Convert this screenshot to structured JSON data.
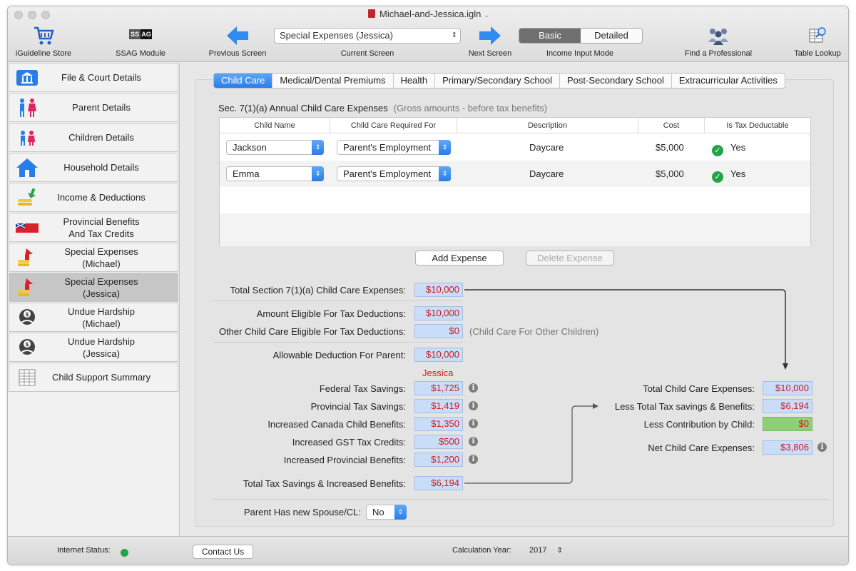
{
  "window": {
    "title": "Michael-and-Jessica.igln"
  },
  "toolbar": {
    "store_label": "iGuideline Store",
    "ssag_label": "SSAG Module",
    "ssag_badge_left": "SS",
    "ssag_badge_right": "AG",
    "prev_label": "Previous Screen",
    "current_label": "Current Screen",
    "current_value": "Special Expenses (Jessica)",
    "next_label": "Next Screen",
    "mode_label": "Income Input Mode",
    "mode_basic": "Basic",
    "mode_detailed": "Detailed",
    "find_label": "Find a Professional",
    "table_label": "Table Lookup"
  },
  "sidebar": {
    "items": [
      {
        "label": "File & Court Details",
        "icon": "courthouse-icon"
      },
      {
        "label": "Parent Details",
        "icon": "parents-icon"
      },
      {
        "label": "Children Details",
        "icon": "children-icon"
      },
      {
        "label": "Household Details",
        "icon": "house-icon"
      },
      {
        "label": "Income & Deductions",
        "icon": "income-icon"
      },
      {
        "label": "Provincial Benefits\nAnd Tax Credits",
        "l1": "Provincial Benefits",
        "l2": "And Tax Credits",
        "icon": "flag-icon"
      },
      {
        "l1": "Special Expenses",
        "l2": "(Michael)",
        "icon": "expense-arrow-icon"
      },
      {
        "l1": "Special Expenses",
        "l2": "(Jessica)",
        "icon": "expense-arrow-icon"
      },
      {
        "l1": "Undue Hardship",
        "l2": "(Michael)",
        "icon": "hardship-icon"
      },
      {
        "l1": "Undue Hardship",
        "l2": "(Jessica)",
        "icon": "hardship-icon"
      },
      {
        "label": "Child Support Summary",
        "icon": "summary-icon"
      }
    ]
  },
  "tabs": [
    "Child Care",
    "Medical/Dental Premiums",
    "Health",
    "Primary/Secondary School",
    "Post-Secondary School",
    "Extracurricular Activities"
  ],
  "section": {
    "title": "Sec. 7(1)(a) Annual Child Care Expenses",
    "subtitle": "(Gross amounts - before tax benefits)"
  },
  "table": {
    "headers": [
      "Child Name",
      "Child Care Required For",
      "Description",
      "Cost",
      "Is Tax Deductable"
    ],
    "rows": [
      {
        "child": "Jackson",
        "required_for": "Parent's Employment",
        "description": "Daycare",
        "cost": "$5,000",
        "deductible": "Yes"
      },
      {
        "child": "Emma",
        "required_for": "Parent's Employment",
        "description": "Daycare",
        "cost": "$5,000",
        "deductible": "Yes"
      }
    ]
  },
  "buttons": {
    "add": "Add Expense",
    "delete": "Delete Expense"
  },
  "totals": {
    "total_label": "Total Section 7(1)(a) Child Care Expenses:",
    "total_value": "$10,000",
    "eligible_label": "Amount Eligible For Tax Deductions:",
    "eligible_value": "$10,000",
    "other_label": "Other Child Care Eligible For Tax Deductions:",
    "other_value": "$0",
    "other_note": "(Child Care For Other Children)",
    "allowable_label": "Allowable Deduction For Parent:",
    "allowable_value": "$10,000"
  },
  "benefits": {
    "parent_name": "Jessica",
    "federal_label": "Federal Tax Savings:",
    "federal_value": "$1,725",
    "provincial_label": "Provincial Tax Savings:",
    "provincial_value": "$1,419",
    "ccb_label": "Increased Canada Child Benefits:",
    "ccb_value": "$1,350",
    "gst_label": "Increased GST Tax Credits:",
    "gst_value": "$500",
    "prov_ben_label": "Increased Provincial Benefits:",
    "prov_ben_value": "$1,200",
    "total_label": "Total Tax Savings & Increased Benefits:",
    "total_value": "$6,194"
  },
  "net": {
    "total_label": "Total Child Care Expenses:",
    "total_value": "$10,000",
    "less_label": "Less Total Tax savings & Benefits:",
    "less_value": "$6,194",
    "contrib_label": "Less Contribution by Child:",
    "contrib_value": "$0",
    "net_label": "Net Child Care Expenses:",
    "net_value": "$3,806"
  },
  "spouse": {
    "label": "Parent Has new Spouse/CL:",
    "value": "No"
  },
  "status": {
    "internet_label": "Internet Status:",
    "contact_label": "Contact Us",
    "year_label": "Calculation Year:",
    "year_value": "2017"
  },
  "colors": {
    "accent": "#2a7de9",
    "value_red": "#d21a1a",
    "value_bg": "#c9dcf8",
    "online": "#21a34a"
  }
}
